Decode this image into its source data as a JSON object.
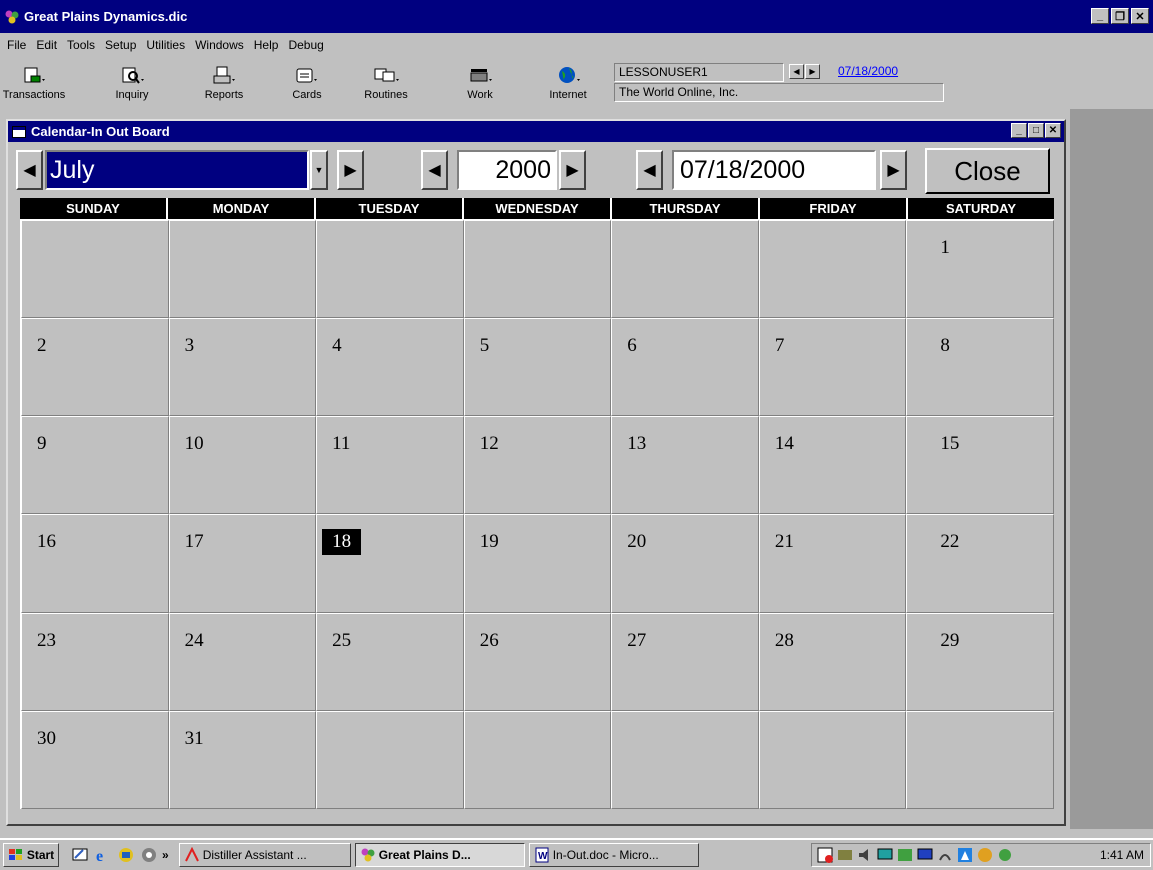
{
  "app": {
    "title": "Great Plains Dynamics.dic"
  },
  "menu": [
    "File",
    "Edit",
    "Tools",
    "Setup",
    "Utilities",
    "Windows",
    "Help",
    "Debug"
  ],
  "toolbar": {
    "buttons": [
      "Transactions",
      "Inquiry",
      "Reports",
      "Cards",
      "Routines",
      "Work",
      "Internet"
    ],
    "user": "LESSONUSER1",
    "user_date": "07/18/2000",
    "company": "The World Online, Inc."
  },
  "calendar": {
    "window_title": "Calendar-In Out Board",
    "month": "July",
    "year": "2000",
    "date": "07/18/2000",
    "close_label": "Close",
    "day_names": [
      "SUNDAY",
      "MONDAY",
      "TUESDAY",
      "WEDNESDAY",
      "THURSDAY",
      "FRIDAY",
      "SATURDAY"
    ],
    "weeks": [
      [
        "",
        "",
        "",
        "",
        "",
        "",
        "1"
      ],
      [
        "2",
        "3",
        "4",
        "5",
        "6",
        "7",
        "8"
      ],
      [
        "9",
        "10",
        "11",
        "12",
        "13",
        "14",
        "15"
      ],
      [
        "16",
        "17",
        "18",
        "19",
        "20",
        "21",
        "22"
      ],
      [
        "23",
        "24",
        "25",
        "26",
        "27",
        "28",
        "29"
      ],
      [
        "30",
        "31",
        "",
        "",
        "",
        "",
        ""
      ]
    ],
    "selected_day": "18"
  },
  "taskbar": {
    "start": "Start",
    "tasks": [
      "Distiller Assistant ...",
      "Great Plains D...",
      "In-Out.doc - Micro..."
    ],
    "active_task": 1,
    "clock": "1:41 AM"
  }
}
